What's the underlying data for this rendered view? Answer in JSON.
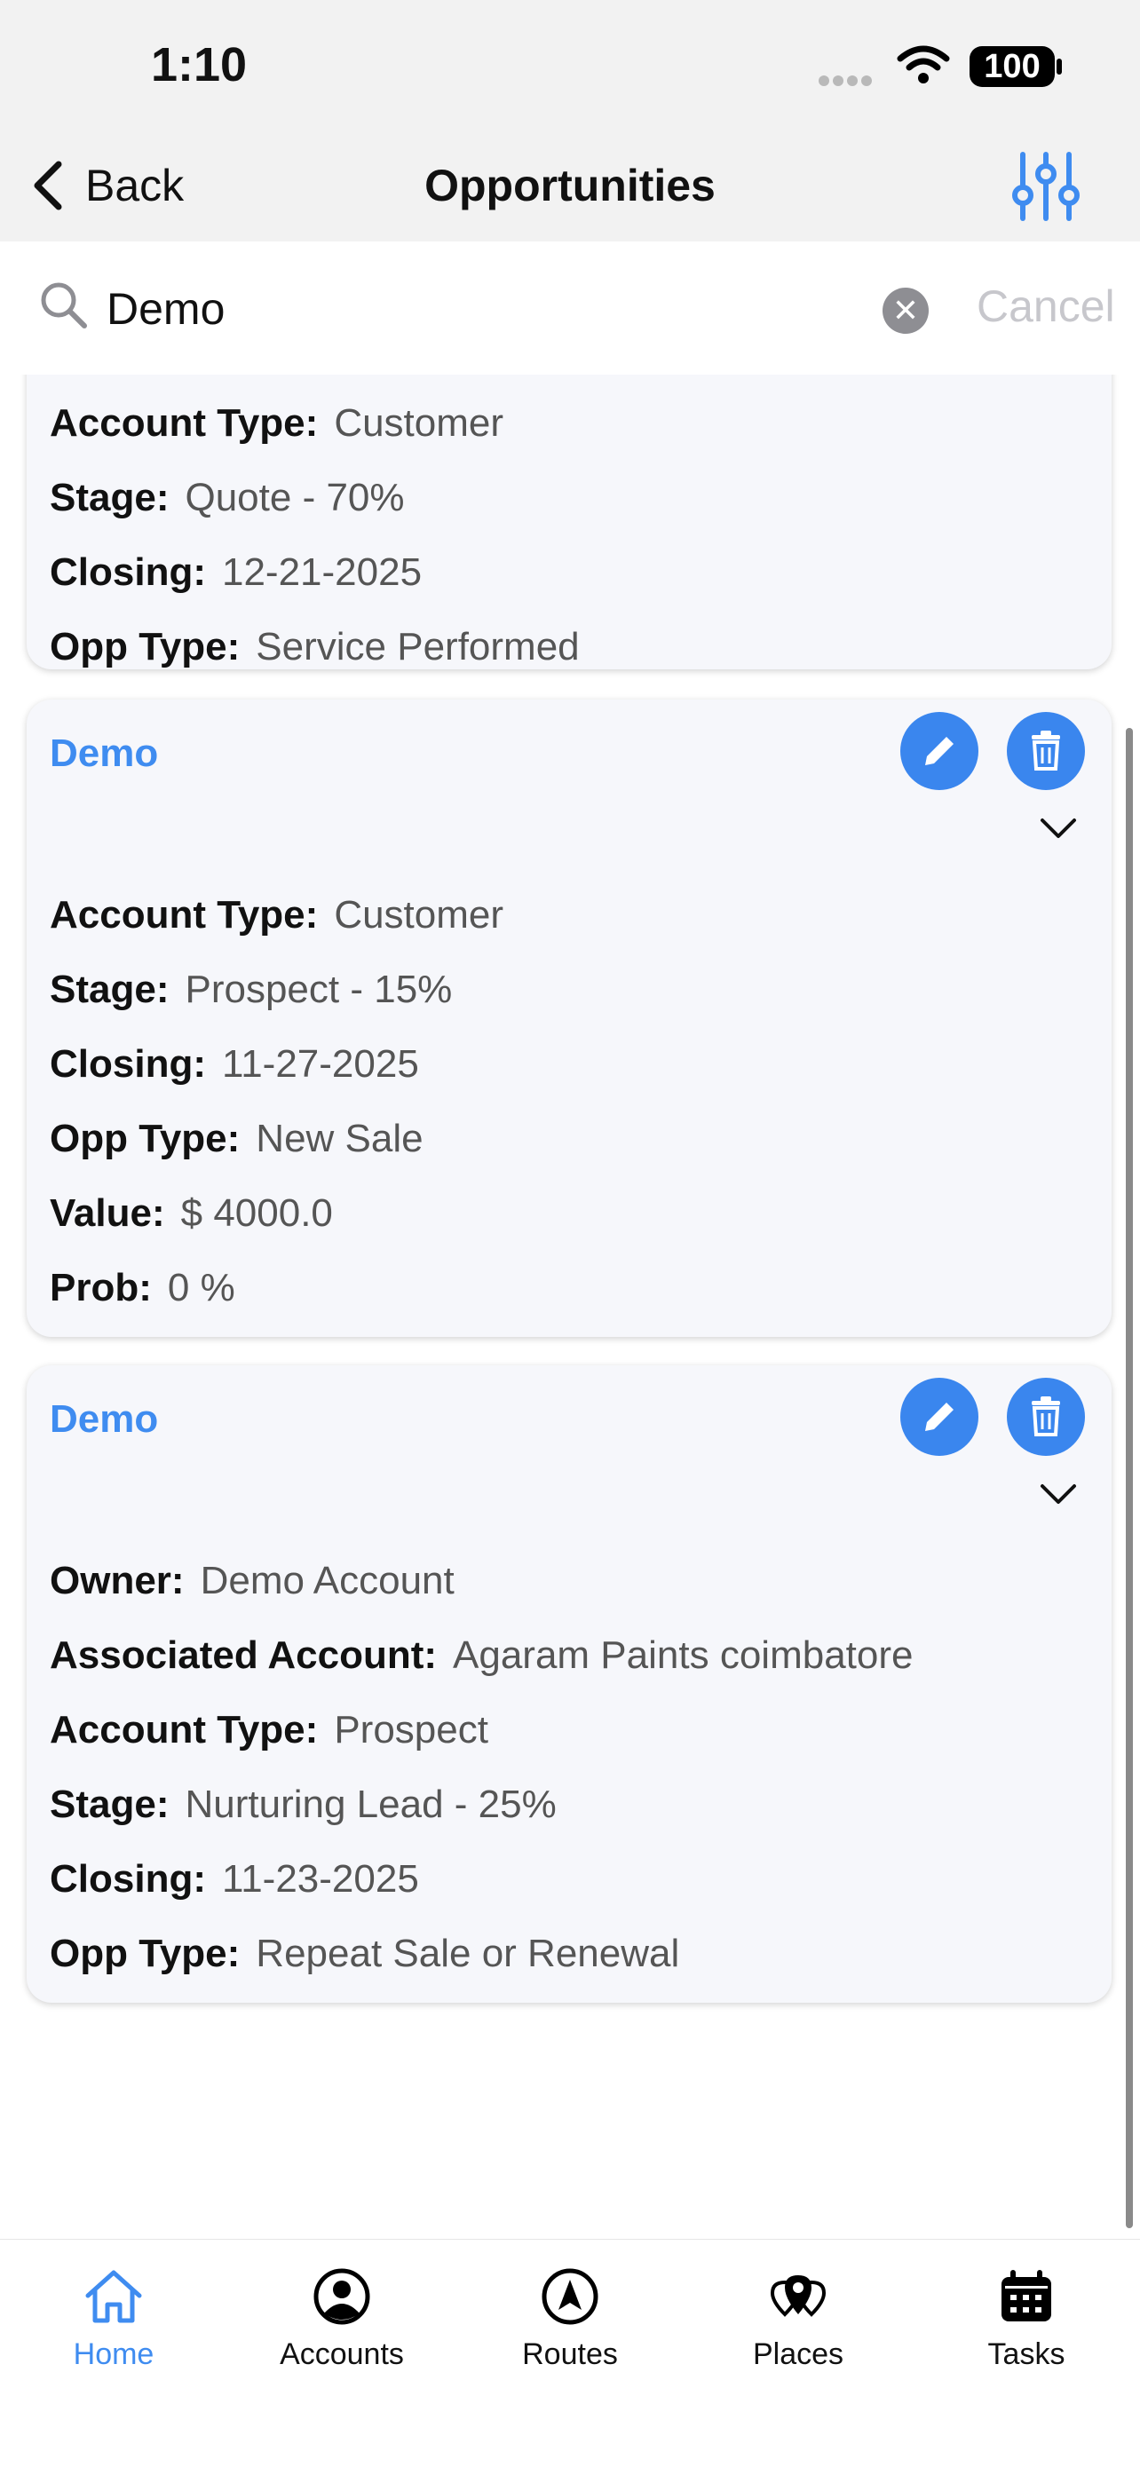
{
  "status_bar": {
    "time": "1:10",
    "battery": "100"
  },
  "nav": {
    "back_label": "Back",
    "title": "Opportunities"
  },
  "search": {
    "value": "Demo",
    "cancel_label": "Cancel"
  },
  "cards": [
    {
      "title": "",
      "rows": [
        {
          "label": "Account Type:",
          "value": "Customer"
        },
        {
          "label": "Stage:",
          "value": "Quote - 70%"
        },
        {
          "label": "Closing:",
          "value": "12-21-2025"
        },
        {
          "label": "Opp Type:",
          "value": "Service Performed"
        }
      ]
    },
    {
      "title": "Demo",
      "rows": [
        {
          "label": "Account Type:",
          "value": "Customer"
        },
        {
          "label": "Stage:",
          "value": "Prospect - 15%"
        },
        {
          "label": "Closing:",
          "value": "11-27-2025"
        },
        {
          "label": "Opp Type:",
          "value": "New Sale"
        },
        {
          "label": "Value:",
          "value": "$ 4000.0"
        },
        {
          "label": "Prob:",
          "value": "0 %"
        }
      ]
    },
    {
      "title": "Demo",
      "rows": [
        {
          "label": "Owner:",
          "value": "Demo Account"
        },
        {
          "label": "Associated Account:",
          "value": "Agaram Paints coimbatore"
        },
        {
          "label": "Account Type:",
          "value": "Prospect"
        },
        {
          "label": "Stage:",
          "value": "Nurturing Lead - 25%"
        },
        {
          "label": "Closing:",
          "value": "11-23-2025"
        },
        {
          "label": "Opp Type:",
          "value": "Repeat Sale or Renewal"
        }
      ]
    }
  ],
  "tabs": [
    {
      "label": "Home",
      "icon": "home-icon",
      "active": true
    },
    {
      "label": "Accounts",
      "icon": "account-circle-icon",
      "active": false
    },
    {
      "label": "Routes",
      "icon": "navigation-icon",
      "active": false
    },
    {
      "label": "Places",
      "icon": "places-pins-icon",
      "active": false
    },
    {
      "label": "Tasks",
      "icon": "calendar-icon",
      "active": false
    }
  ],
  "colors": {
    "accent": "#3f8cf0",
    "action_button": "#3a86ee",
    "card_bg": "#f6f7fb"
  }
}
